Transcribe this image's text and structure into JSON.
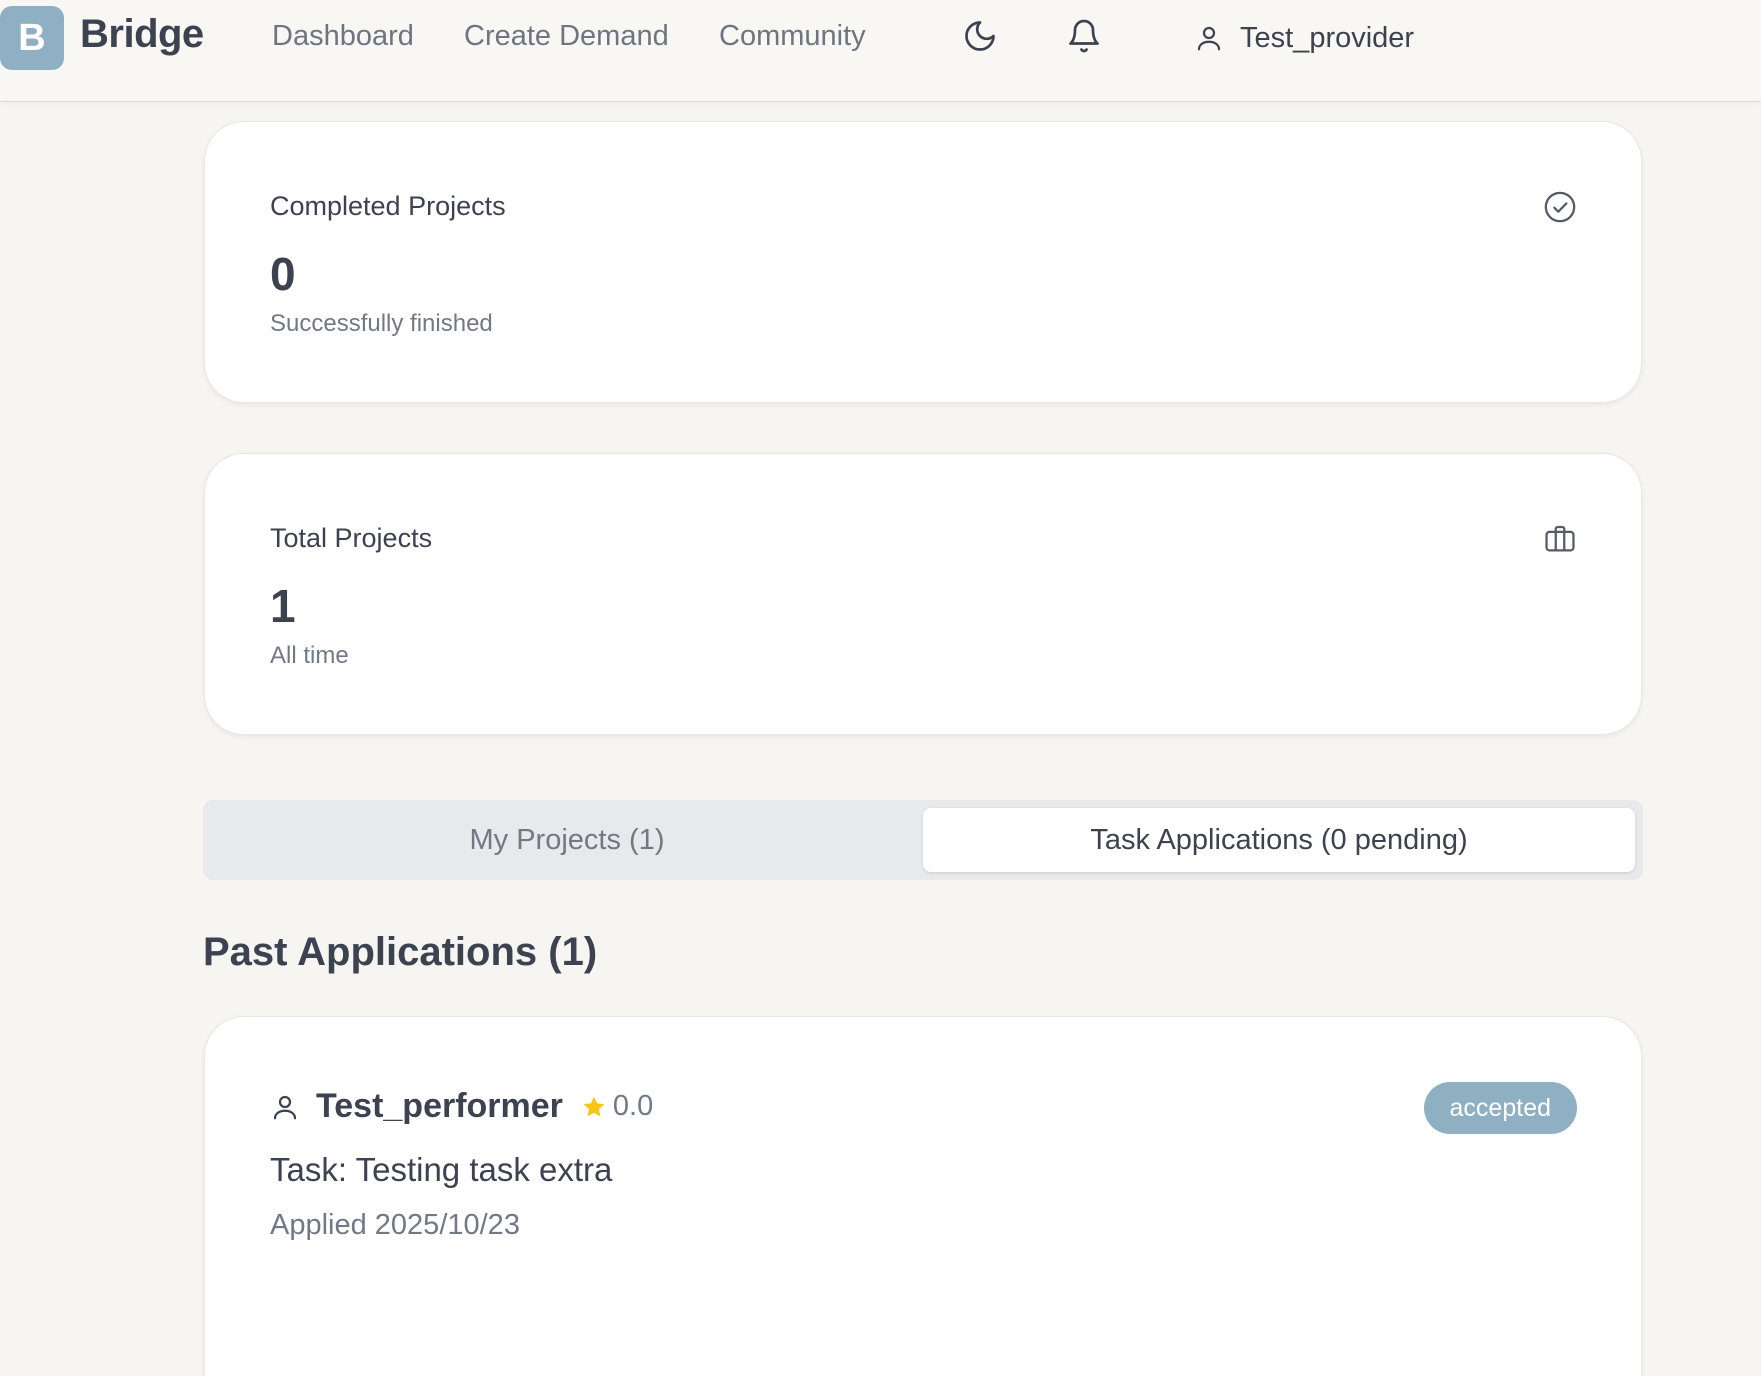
{
  "nav": {
    "logo_letter": "B",
    "brand": "Bridge",
    "links": [
      "Dashboard",
      "Create Demand",
      "Community"
    ],
    "username": "Test_provider"
  },
  "stats": {
    "completed": {
      "title": "Completed Projects",
      "value": "0",
      "subtitle": "Successfully finished",
      "icon": "check-circle-icon"
    },
    "total": {
      "title": "Total Projects",
      "value": "1",
      "subtitle": "All time",
      "icon": "briefcase-icon"
    }
  },
  "tabs": {
    "my_projects": "My Projects (1)",
    "task_applications": "Task Applications (0 pending)",
    "active": "task_applications"
  },
  "past_applications": {
    "heading": "Past Applications (1)",
    "items": [
      {
        "performer": "Test_performer",
        "rating": "0.0",
        "status": "accepted",
        "task": "Task: Testing task extra",
        "applied": "Applied 2025/10/23"
      }
    ]
  },
  "colors": {
    "accent": "#8fb0c2",
    "background": "#f6f5f2",
    "text": "#3d4250",
    "muted": "#717986",
    "star": "#f5c518"
  }
}
